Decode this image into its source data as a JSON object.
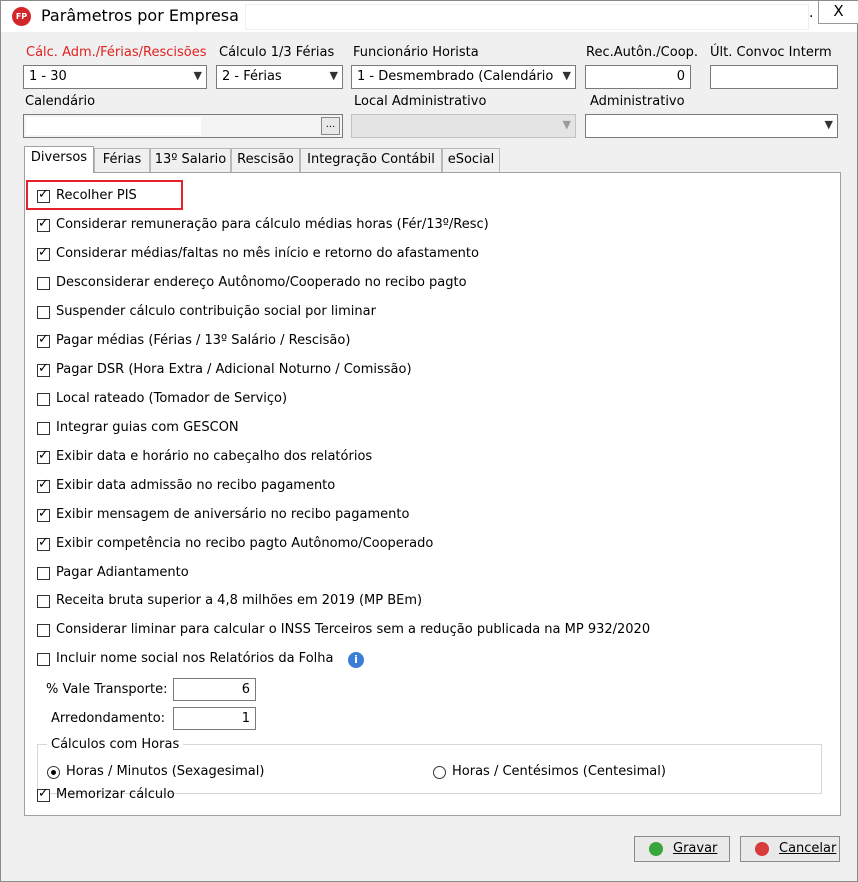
{
  "window": {
    "title": "Parâmetros por Empresa",
    "title_suffix": ".",
    "app_icon_text": "FP",
    "close_glyph": "X"
  },
  "fields": {
    "calc_adm": {
      "label": "Cálc. Adm./Férias/Rescisões",
      "value": "1 - 30"
    },
    "calc_terco": {
      "label": "Cálculo 1/3 Férias",
      "value": "2 - Férias"
    },
    "func_horista": {
      "label": "Funcionário Horista",
      "value": "1 - Desmembrado (Calendário"
    },
    "rec_auton": {
      "label": "Rec.Autôn./Coop.",
      "value": "0"
    },
    "ult_convoc": {
      "label": "Últ. Convoc Interm",
      "value": ""
    },
    "calendario": {
      "label": "Calendário",
      "value": "",
      "button": "..."
    },
    "local_adm": {
      "label": "Local Administrativo",
      "value": ""
    },
    "administrativo": {
      "label": "Administrativo",
      "value": ""
    }
  },
  "tabs": [
    {
      "label": "Diversos",
      "active": true
    },
    {
      "label": "Férias",
      "active": false
    },
    {
      "label": "13º Salario",
      "active": false
    },
    {
      "label": "Rescisão",
      "active": false
    },
    {
      "label": "Integração Contábil",
      "active": false
    },
    {
      "label": "eSocial",
      "active": false
    }
  ],
  "checkboxes": [
    {
      "label": "Recolher PIS",
      "checked": true
    },
    {
      "label": "Considerar remuneração para cálculo médias horas (Fér/13º/Resc)",
      "checked": true
    },
    {
      "label": "Considerar médias/faltas no mês início e retorno do afastamento",
      "checked": true
    },
    {
      "label": "Desconsiderar endereço Autônomo/Cooperado no recibo pagto",
      "checked": false
    },
    {
      "label": "Suspender cálculo contribuição social por liminar",
      "checked": false
    },
    {
      "label": "Pagar médias (Férias / 13º Salário / Rescisão)",
      "checked": true
    },
    {
      "label": "Pagar DSR (Hora Extra / Adicional Noturno / Comissão)",
      "checked": true
    },
    {
      "label": "Local rateado (Tomador de Serviço)",
      "checked": false
    },
    {
      "label": "Integrar guias com GESCON",
      "checked": false
    },
    {
      "label": "Exibir data e horário no cabeçalho dos relatórios",
      "checked": true
    },
    {
      "label": "Exibir data admissão no recibo pagamento",
      "checked": true
    },
    {
      "label": "Exibir mensagem de aniversário no recibo pagamento",
      "checked": true
    },
    {
      "label": "Exibir competência no recibo pagto Autônomo/Cooperado",
      "checked": true
    },
    {
      "label": "Pagar Adiantamento",
      "checked": false
    },
    {
      "label": "Receita bruta superior a 4,8 milhões em 2019 (MP BEm)",
      "checked": false
    },
    {
      "label": "Considerar liminar para calcular o INSS Terceiros sem a redução publicada na MP 932/2020",
      "checked": false
    },
    {
      "label": "Incluir nome social nos Relatórios da Folha",
      "checked": false
    }
  ],
  "info_glyph": "i",
  "vale_transporte": {
    "label": "% Vale Transporte:",
    "value": "6"
  },
  "arredondamento": {
    "label": "Arredondamento:",
    "value": "1"
  },
  "calculos_horas": {
    "title": "Cálculos com Horas",
    "options": [
      {
        "label": "Horas / Minutos (Sexagesimal)",
        "selected": true
      },
      {
        "label": "Horas / Centésimos (Centesimal)",
        "selected": false
      }
    ]
  },
  "memorizar": {
    "label": "Memorizar cálculo",
    "checked": true
  },
  "buttons": {
    "gravar": "Gravar",
    "cancelar": "Cancelar"
  },
  "colors": {
    "highlight": "#e5212b",
    "required_label": "#e02020",
    "info": "#3b7dd8",
    "gravar_icon": "#3aa53a",
    "cancelar_icon": "#d93a3a"
  }
}
